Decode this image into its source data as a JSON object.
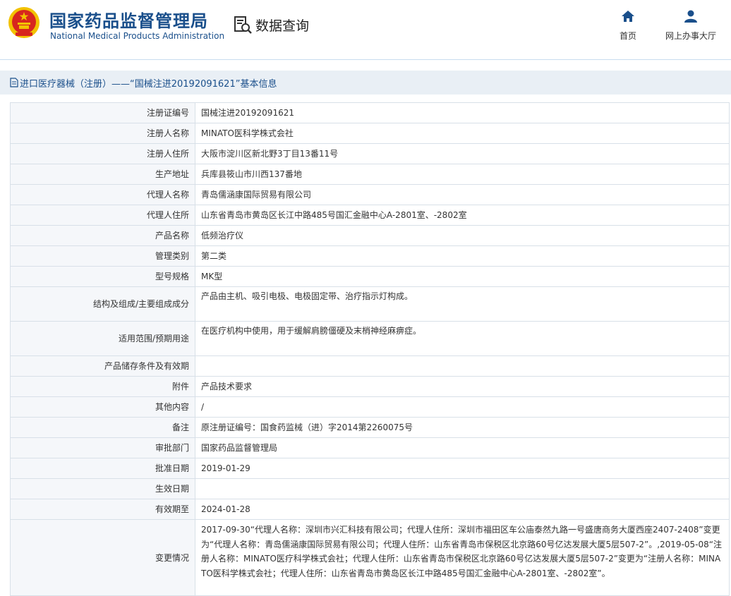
{
  "header": {
    "brand_cn": "国家药品监督管理局",
    "brand_en": "National Medical Products Administration",
    "query_label": "数据查询",
    "nav": [
      {
        "label": "首页",
        "icon": "home-icon"
      },
      {
        "label": "网上办事大厅",
        "icon": "user-icon"
      }
    ]
  },
  "colors": {
    "brand": "#1a4f8b",
    "emblem_red": "#d7261e",
    "emblem_gold": "#f2c200",
    "label_bg": "#f5f7fa",
    "border": "#d8e0e8"
  },
  "title_bar": {
    "text": "进口医疗器械（注册）——“国械注进20192091621”基本信息"
  },
  "rows": [
    {
      "label": "注册证编号",
      "value": "国械注进20192091621"
    },
    {
      "label": "注册人名称",
      "value": "MINATO医科学株式会社"
    },
    {
      "label": "注册人住所",
      "value": "大阪市淀川区新北野3丁目13番11号"
    },
    {
      "label": "生产地址",
      "value": "兵库县筱山市川西137番地"
    },
    {
      "label": "代理人名称",
      "value": "青岛儒涵康国际贸易有限公司"
    },
    {
      "label": "代理人住所",
      "value": "山东省青岛市黄岛区长江中路485号国汇金融中心A-2801室、-2802室"
    },
    {
      "label": "产品名称",
      "value": "低频治疗仪"
    },
    {
      "label": "管理类别",
      "value": "第二类"
    },
    {
      "label": "型号规格",
      "value": "MK型"
    },
    {
      "label": "结构及组成/主要组成成分",
      "value": "产品由主机、吸引电极、电极固定带、治疗指示灯构成。"
    },
    {
      "label": "适用范围/预期用途",
      "value": "在医疗机构中使用，用于缓解肩膀僵硬及末梢神经麻痹症。"
    },
    {
      "label": "产品储存条件及有效期",
      "value": ""
    },
    {
      "label": "附件",
      "value": "产品技术要求"
    },
    {
      "label": "其他内容",
      "value": "/"
    },
    {
      "label": "备注",
      "value": "原注册证编号：国食药监械（进）字2014第2260075号"
    },
    {
      "label": "审批部门",
      "value": "国家药品监督管理局"
    },
    {
      "label": "批准日期",
      "value": "2019-01-29"
    },
    {
      "label": "生效日期",
      "value": ""
    },
    {
      "label": "有效期至",
      "value": "2024-01-28"
    },
    {
      "label": "变更情况",
      "value": "2017-09-30“代理人名称：深圳市兴汇科技有限公司；代理人住所：深圳市福田区车公庙泰然九路一号盛唐商务大厦西座2407-2408”变更为“代理人名称：青岛儒涵康国际贸易有限公司；代理人住所：山东省青岛市保税区北京路60号亿达发展大厦5层507-2”。,2019-05-08“注册人名称：MINATO医疗科学株式会社；代理人住所：山东省青岛市保税区北京路60号亿达发展大厦5层507-2”变更为“注册人名称：MINATO医科学株式会社；代理人住所：山东省青岛市黄岛区长江中路485号国汇金融中心A-2801室、-2802室”。"
    }
  ]
}
